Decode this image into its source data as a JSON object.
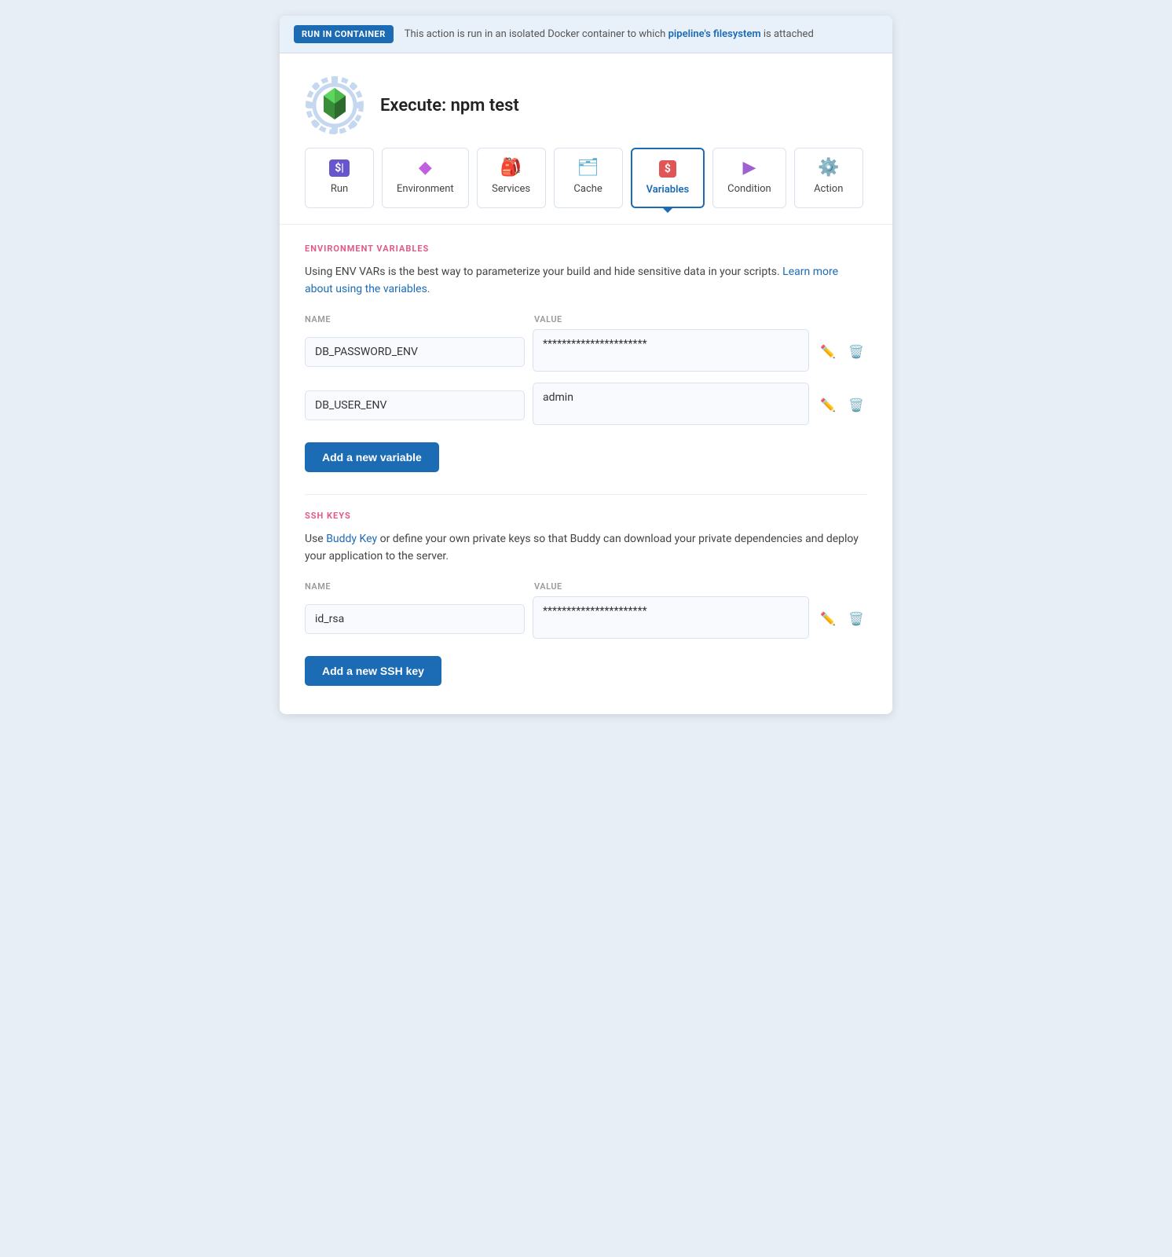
{
  "banner": {
    "badge": "RUN IN CONTAINER",
    "text": "This action is run in an isolated Docker container to which ",
    "link_text": "pipeline's filesystem",
    "text_after": " is attached"
  },
  "header": {
    "title": "Execute: npm test"
  },
  "tabs": [
    {
      "id": "run",
      "label": "Run",
      "icon": "💲",
      "active": false
    },
    {
      "id": "environment",
      "label": "Environment",
      "icon": "◆",
      "active": false
    },
    {
      "id": "services",
      "label": "Services",
      "icon": "🎒",
      "active": false
    },
    {
      "id": "cache",
      "label": "Cache",
      "icon": "📄",
      "active": false
    },
    {
      "id": "variables",
      "label": "Variables",
      "icon": "💲",
      "active": true
    },
    {
      "id": "condition",
      "label": "Condition",
      "icon": "▶",
      "active": false
    },
    {
      "id": "action",
      "label": "Action",
      "icon": "🔧",
      "active": false
    }
  ],
  "env_vars": {
    "section_label": "ENVIRONMENT VARIABLES",
    "description": "Using ENV VARs is the best way to parameterize your build and hide sensitive data in your scripts. ",
    "link_text": "Learn more about using the variables.",
    "name_label": "NAME",
    "value_label": "VALUE",
    "rows": [
      {
        "name": "DB_PASSWORD_ENV",
        "value": "**********************",
        "masked": true
      },
      {
        "name": "DB_USER_ENV",
        "value": "admin",
        "masked": false
      }
    ],
    "add_button": "Add a new variable"
  },
  "ssh_keys": {
    "section_label": "SSH KEYS",
    "description_start": "Use ",
    "buddy_key_link": "Buddy Key",
    "description_end": " or define your own private keys so that Buddy can download your private dependencies and deploy your application to the server.",
    "name_label": "NAME",
    "value_label": "VALUE",
    "rows": [
      {
        "name": "id_rsa",
        "value": "**********************",
        "masked": true
      }
    ],
    "add_button": "Add a new SSH key"
  },
  "icons": {
    "edit": "✏",
    "delete": "🗑"
  }
}
